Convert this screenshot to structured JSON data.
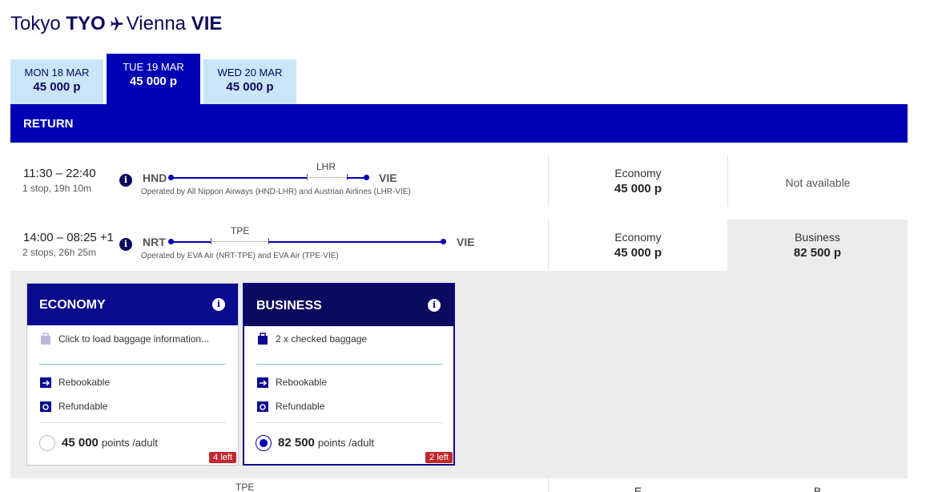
{
  "route": {
    "origin_city": "Tokyo",
    "origin_code": "TYO",
    "destination_city": "Vienna",
    "destination_code": "VIE"
  },
  "date_tabs": [
    {
      "date": "MON 18 MAR",
      "price": "45 000 p",
      "active": false
    },
    {
      "date": "TUE 19 MAR",
      "price": "45 000 p",
      "active": true
    },
    {
      "date": "WED 20 MAR",
      "price": "45 000 p",
      "active": false
    }
  ],
  "section_label": "RETURN",
  "flights": [
    {
      "times": "11:30 – 22:40",
      "stops": "1 stop, 19h 10m",
      "from": "HND",
      "to": "VIE",
      "via": [
        "LHR"
      ],
      "operated": "Operated by All Nippon Airways (HND-LHR) and Austrian Airlines (LHR-VIE)",
      "economy": {
        "class": "Economy",
        "points": "45 000 p"
      },
      "business": {
        "text": "Not available"
      }
    },
    {
      "times": "14:00 – 08:25 +1",
      "stops": "2 stops, 26h 25m",
      "from": "NRT",
      "to": "VIE",
      "via": [
        "TPE"
      ],
      "operated": "Operated by EVA Air (NRT-TPE) and EVA Air (TPE-VIE)",
      "economy": {
        "class": "Economy",
        "points": "45 000 p"
      },
      "business": {
        "class": "Business",
        "points": "82 500 p"
      }
    }
  ],
  "fare_cards": [
    {
      "title": "ECONOMY",
      "baggage": "Click to load baggage information...",
      "rebookable": "Rebookable",
      "refundable": "Refundable",
      "points": "45 000",
      "unit": "points /adult",
      "seats_left": "4 left",
      "selected": false
    },
    {
      "title": "BUSINESS",
      "baggage": "2 x checked baggage",
      "rebookable": "Rebookable",
      "refundable": "Refundable",
      "points": "82 500",
      "unit": "points /adult",
      "seats_left": "2 left",
      "selected": true
    }
  ],
  "partial_row": {
    "via": "TPE",
    "economy_class": "E",
    "business_class": "B"
  },
  "colors": {
    "brand_blue": "#0000b4",
    "navy": "#0a0a5e",
    "tab_light": "#c8e6f7",
    "badge_red": "#c0282e"
  }
}
